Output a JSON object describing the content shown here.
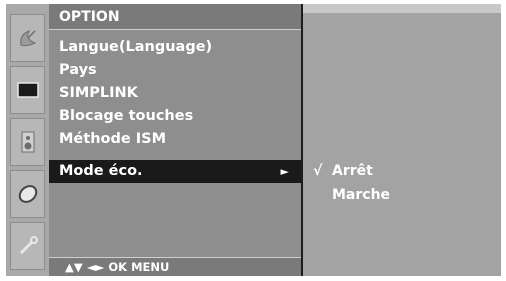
{
  "menu": {
    "title": "OPTION",
    "items": [
      {
        "label": "Langue(Language)"
      },
      {
        "label": "Pays"
      },
      {
        "label": "SIMPLINK"
      },
      {
        "label": "Blocage touches"
      },
      {
        "label": "Méthode ISM"
      },
      {
        "label": "Mode éco.",
        "selected": true,
        "arrow": "►"
      }
    ]
  },
  "sidebar": {
    "icons": [
      "satellite-dish-icon",
      "monitor-icon",
      "speaker-icon",
      "clock-icon",
      "wrench-icon"
    ]
  },
  "submenu": {
    "options": [
      {
        "label": "Arrêt",
        "check": "√",
        "checked": true
      },
      {
        "label": "Marche",
        "check": "",
        "checked": false
      }
    ]
  },
  "nav": {
    "hint": "▲▼ ◄► OK MENU"
  },
  "colors": {
    "panel": "#8e8e8e",
    "highlight": "#1a1a1a",
    "subpanel": "#a3a3a3",
    "text": "#ffffff"
  }
}
